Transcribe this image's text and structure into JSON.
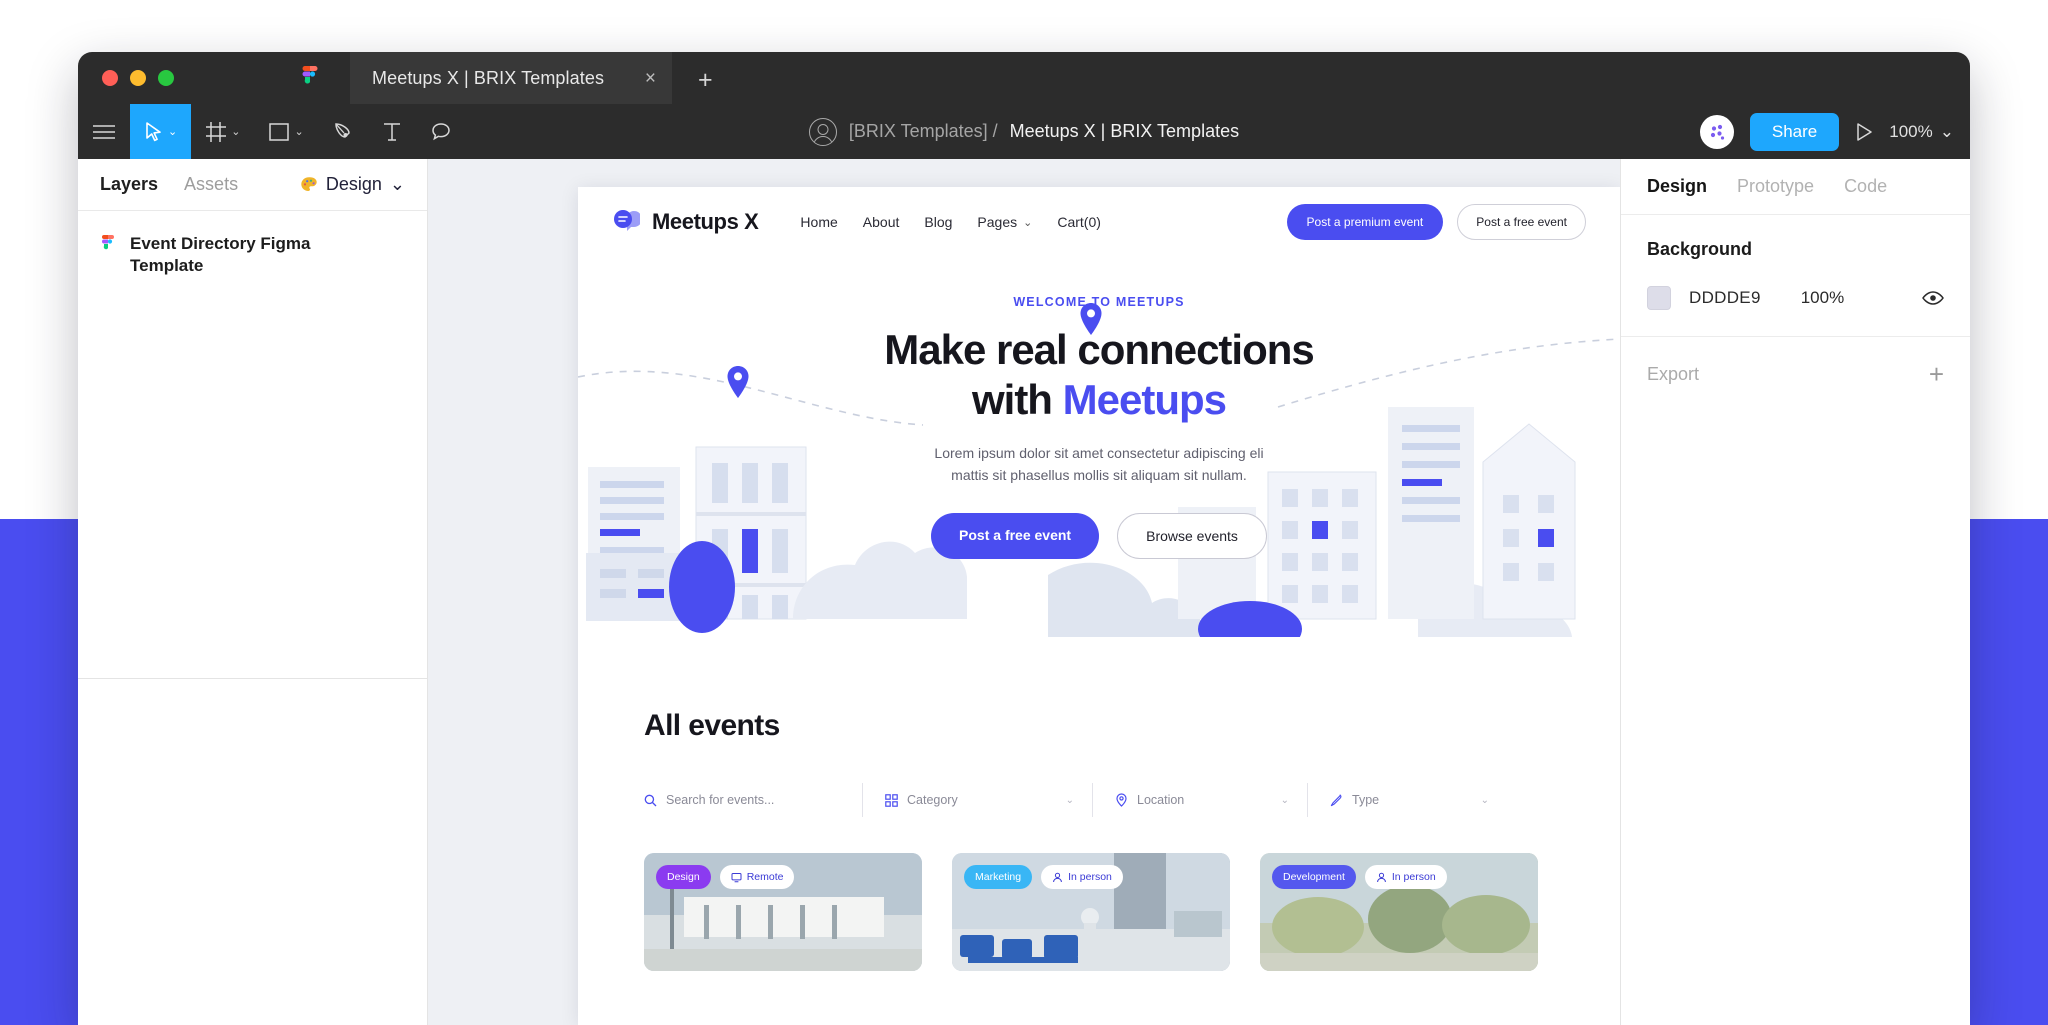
{
  "window": {
    "tab_title": "Meetups X | BRIX Templates",
    "close_label": "×",
    "newtab_label": "+",
    "app_icon": "figma-logo-icon"
  },
  "toolbar": {
    "tools": [
      {
        "name": "main-menu",
        "icon": "hamburger-menu-icon",
        "caret": false,
        "active": false
      },
      {
        "name": "move-tool",
        "icon": "cursor-arrow-icon",
        "caret": true,
        "active": true
      },
      {
        "name": "frame-tool",
        "icon": "frame-icon",
        "caret": true,
        "active": false
      },
      {
        "name": "shape-tool",
        "icon": "rectangle-icon",
        "caret": true,
        "active": false
      },
      {
        "name": "pen-tool",
        "icon": "pen-nib-icon",
        "caret": false,
        "active": false
      },
      {
        "name": "text-tool",
        "icon": "text-t-icon",
        "caret": false,
        "active": false
      },
      {
        "name": "comment-tool",
        "icon": "comment-bubble-icon",
        "caret": false,
        "active": false
      }
    ],
    "caret_glyph": "⌄",
    "breadcrumb": {
      "avatar_icon": "user-avatar-icon",
      "team": "[BRIX Templates] /",
      "file": "Meetups X | BRIX Templates"
    },
    "multiplayer_icon": "multiplayer-avatar-icon",
    "share_label": "Share",
    "present_icon": "play-present-icon",
    "zoom_level": "100%",
    "zoom_caret": "⌄"
  },
  "left_panel": {
    "tabs": [
      {
        "label": "Layers",
        "active": true
      },
      {
        "label": "Assets",
        "active": false
      }
    ],
    "design_label": "Design",
    "design_icon": "palette-icon",
    "design_caret": "⌄",
    "layer": {
      "icon": "figma-file-icon",
      "name": "Event Directory Figma Template"
    }
  },
  "right_panel": {
    "tabs": [
      {
        "label": "Design",
        "active": true
      },
      {
        "label": "Prototype",
        "active": false
      },
      {
        "label": "Code",
        "active": false
      }
    ],
    "background": {
      "title": "Background",
      "hex": "DDDDE9",
      "swatch_color": "#DDDDE9",
      "opacity": "100%",
      "visibility_icon": "eye-icon"
    },
    "export": {
      "label": "Export",
      "add_icon": "plus-icon",
      "add_glyph": "+"
    }
  },
  "site": {
    "nav": {
      "logo_icon": "meetups-chat-bubble-icon",
      "brand": "Meetups X",
      "links": [
        {
          "label": "Home",
          "caret": false
        },
        {
          "label": "About",
          "caret": false
        },
        {
          "label": "Blog",
          "caret": false
        },
        {
          "label": "Pages",
          "caret": true
        },
        {
          "label": "Cart(0)",
          "caret": false
        }
      ],
      "caret_glyph": "⌄",
      "cta_primary": "Post a premium event",
      "cta_secondary": "Post a free event"
    },
    "hero": {
      "eyebrow": "WELCOME TO MEETUPS",
      "heading_line1": "Make real connections",
      "heading_line2_plain": "with ",
      "heading_line2_accent": "Meetups",
      "subtext_line1": "Lorem ipsum dolor sit amet consectetur adipiscing eli",
      "subtext_line2": "mattis sit phasellus mollis sit aliquam sit nullam.",
      "cta_primary": "Post a free event",
      "cta_secondary": "Browse events",
      "pin_icon": "map-pin-icon"
    },
    "events": {
      "title": "All events",
      "filters": [
        {
          "label": "Search for events...",
          "icon": "search-icon",
          "caret": false
        },
        {
          "label": "Category",
          "icon": "grid-category-icon",
          "caret": true
        },
        {
          "label": "Location",
          "icon": "location-pin-icon",
          "caret": true
        },
        {
          "label": "Type",
          "icon": "pencil-type-icon",
          "caret": true
        }
      ],
      "caret_glyph": "⌄",
      "cards": [
        {
          "category": "Design",
          "category_color": "#8b3bf0",
          "mode": "Remote",
          "mode_icon": "monitor-icon"
        },
        {
          "category": "Marketing",
          "category_color": "#39b6f5",
          "mode": "In person",
          "mode_icon": "person-icon"
        },
        {
          "category": "Development",
          "category_color": "#5458ee",
          "mode": "In person",
          "mode_icon": "person-icon"
        }
      ]
    }
  },
  "colors": {
    "brand_blue": "#4a4df0",
    "figma_blue": "#1ea7fd",
    "window_dark": "#2c2c2c",
    "canvas_bg": "#eef0f4"
  }
}
